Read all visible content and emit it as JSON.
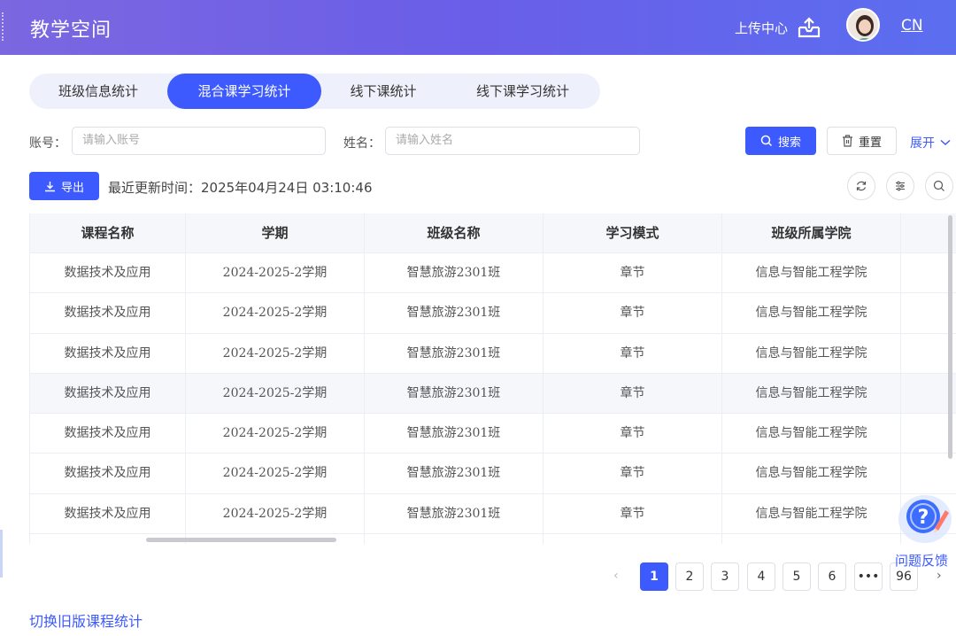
{
  "header": {
    "app_title": "教学空间",
    "upload_label": "上传中心",
    "lang": "CN",
    "upload_icon": "upload-tray-icon",
    "avatar_icon": "user-avatar"
  },
  "tabs": [
    {
      "label": "班级信息统计",
      "active": false
    },
    {
      "label": "混合课学习统计",
      "active": true
    },
    {
      "label": "线下课统计",
      "active": false
    },
    {
      "label": "线下课学习统计",
      "active": false
    }
  ],
  "filters": {
    "account_label": "账号：",
    "account_placeholder": "请输入账号",
    "name_label": "姓名：",
    "name_placeholder": "请输入姓名",
    "search_label": "搜索",
    "reset_label": "重置",
    "expand_label": "展开"
  },
  "toolbar": {
    "export_label": "导出",
    "update_time": "最近更新时间：2025年04月24日 03:10:46",
    "icons": [
      "refresh-icon",
      "column-settings-icon",
      "search-icon"
    ]
  },
  "table": {
    "columns": [
      "课程名称",
      "学期",
      "班级名称",
      "学习模式",
      "班级所属学院",
      ""
    ],
    "rows": [
      [
        "数据技术及应用",
        "2024-2025-2学期",
        "智慧旅游2301班",
        "章节",
        "信息与智能工程学院",
        ""
      ],
      [
        "数据技术及应用",
        "2024-2025-2学期",
        "智慧旅游2301班",
        "章节",
        "信息与智能工程学院",
        ""
      ],
      [
        "数据技术及应用",
        "2024-2025-2学期",
        "智慧旅游2301班",
        "章节",
        "信息与智能工程学院",
        ""
      ],
      [
        "数据技术及应用",
        "2024-2025-2学期",
        "智慧旅游2301班",
        "章节",
        "信息与智能工程学院",
        ""
      ],
      [
        "数据技术及应用",
        "2024-2025-2学期",
        "智慧旅游2301班",
        "章节",
        "信息与智能工程学院",
        ""
      ],
      [
        "数据技术及应用",
        "2024-2025-2学期",
        "智慧旅游2301班",
        "章节",
        "信息与智能工程学院",
        ""
      ],
      [
        "数据技术及应用",
        "2024-2025-2学期",
        "智慧旅游2301班",
        "章节",
        "信息与智能工程学院",
        ""
      ],
      [
        "",
        "",
        "",
        "",
        "",
        ""
      ]
    ],
    "hover_row": 3
  },
  "pagination": {
    "prev": "‹",
    "next": "›",
    "pages": [
      "1",
      "2",
      "3",
      "4",
      "5",
      "6",
      "•••",
      "96"
    ],
    "current": "1"
  },
  "feedback": {
    "label": "问题反馈",
    "icon": "question-feedback-icon"
  },
  "footer": {
    "old_version_link": "切换旧版课程统计"
  },
  "colors": {
    "primary": "#3d5afe",
    "header_start": "#7b67e0",
    "header_end": "#5b6ef0"
  }
}
